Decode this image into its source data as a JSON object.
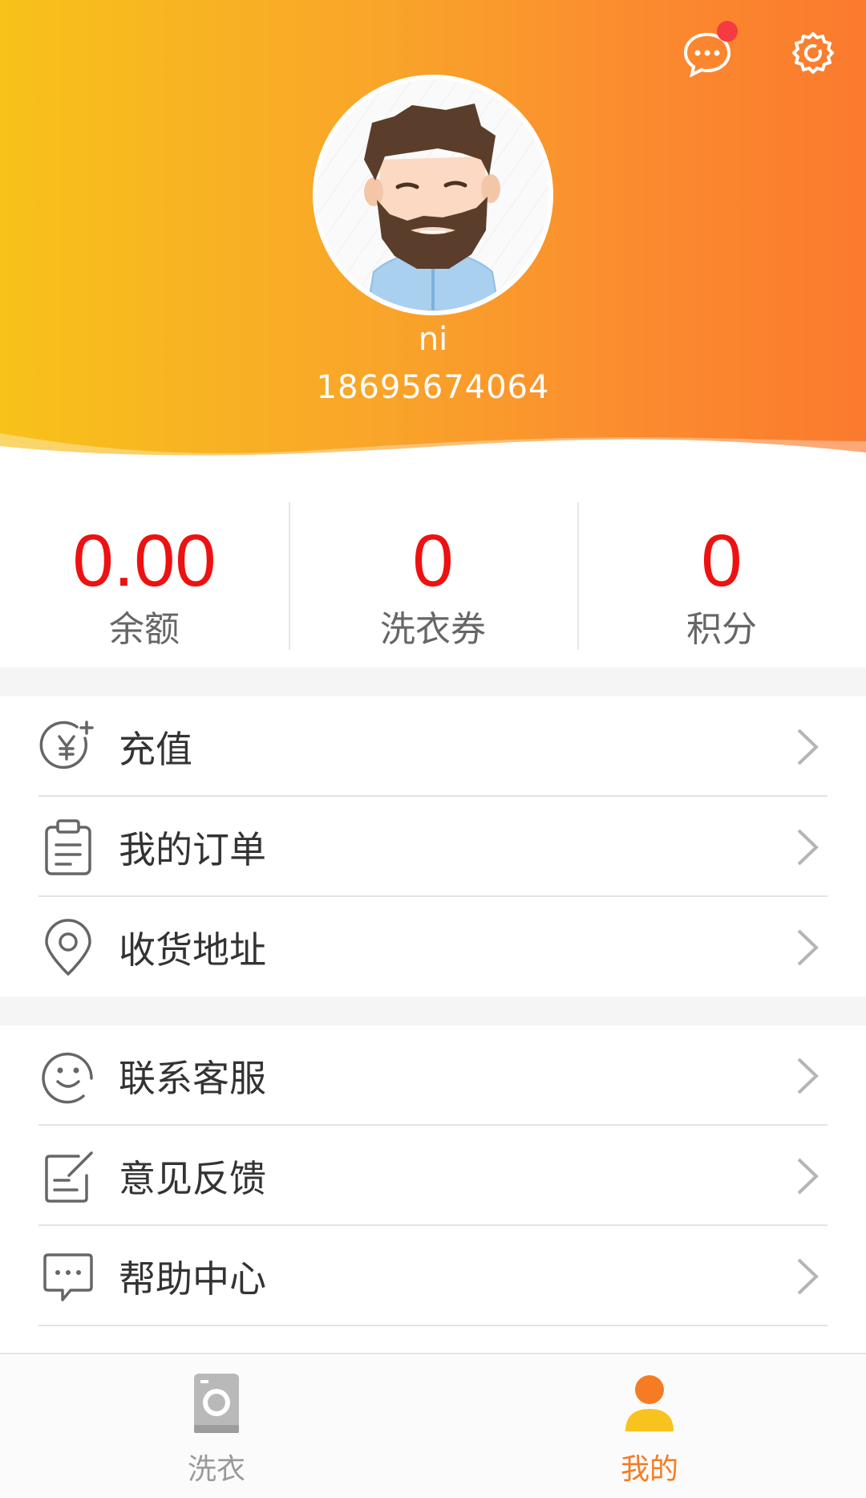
{
  "colors": {
    "header_gradient_start": "#f8c21a",
    "header_gradient_end": "#fb7a2e",
    "stat_value": "#ee1111",
    "accent": "#f57c24",
    "notification_dot": "#f63b40"
  },
  "header": {
    "message_icon": "chat-bubble-icon",
    "settings_icon": "gear-icon",
    "avatar": "bearded-man-avatar"
  },
  "user": {
    "name": "ni",
    "phone": "18695674064"
  },
  "stats": [
    {
      "value": "0.00",
      "label": "余额"
    },
    {
      "value": "0",
      "label": "洗衣券"
    },
    {
      "value": "0",
      "label": "积分"
    }
  ],
  "menu_group_1": [
    {
      "label": "充值",
      "icon": "yuan-plus-icon"
    },
    {
      "label": "我的订单",
      "icon": "clipboard-icon"
    },
    {
      "label": "收货地址",
      "icon": "location-pin-icon"
    }
  ],
  "menu_group_2": [
    {
      "label": "联系客服",
      "icon": "smiley-icon"
    },
    {
      "label": "意见反馈",
      "icon": "edit-note-icon"
    },
    {
      "label": "帮助中心",
      "icon": "message-dots-icon"
    }
  ],
  "tabbar": [
    {
      "label": "洗衣",
      "icon": "washing-machine-icon",
      "active": false
    },
    {
      "label": "我的",
      "icon": "user-icon",
      "active": true
    }
  ]
}
